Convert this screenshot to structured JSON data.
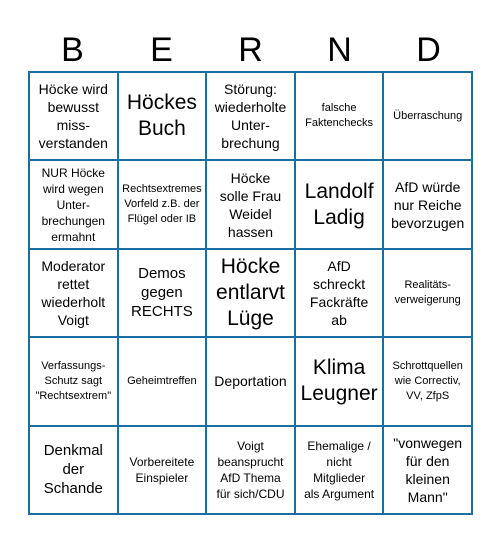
{
  "header": {
    "letters": [
      "B",
      "E",
      "R",
      "N",
      "D"
    ]
  },
  "colors": {
    "grid_border": "#1a6ea0",
    "cell_background": "#ffffff",
    "text": "#000000"
  },
  "board": {
    "rows": [
      [
        {
          "text": "Höcke wird\nbewusst\nmiss-\nverstanden",
          "size": "m"
        },
        {
          "text": "Höckes\nBuch",
          "size": "xl"
        },
        {
          "text": "Störung:\nwiederholte\nUnter-\nbrechung",
          "size": "m"
        },
        {
          "text": "falsche\nFaktenchecks",
          "size": "xs"
        },
        {
          "text": "Überraschung",
          "size": "xs"
        }
      ],
      [
        {
          "text": "NUR Höcke\nwird wegen\nUnter-\nbrechungen\nermahnt",
          "size": "s"
        },
        {
          "text": "Rechtsextremes\nVorfeld z.B. der\nFlügel oder IB",
          "size": "xs"
        },
        {
          "text": "Höcke\nsolle Frau\nWeidel\nhassen",
          "size": "m"
        },
        {
          "text": "Landolf\nLadig",
          "size": "xl"
        },
        {
          "text": "AfD würde\nnur Reiche\nbevorzugen",
          "size": "m"
        }
      ],
      [
        {
          "text": "Moderator\nrettet\nwiederholt\nVoigt",
          "size": "m"
        },
        {
          "text": "Demos\ngegen\nRECHTS",
          "size": "l"
        },
        {
          "text": "Höcke\nentlarvt\nLüge",
          "size": "xl"
        },
        {
          "text": "AfD\nschreckt\nFackräfte\nab",
          "size": "m"
        },
        {
          "text": "Realitäts-\nverweigerung",
          "size": "xs"
        }
      ],
      [
        {
          "text": "Verfassungs-\nSchutz sagt\n\"Rechtsextrem\"",
          "size": "xs"
        },
        {
          "text": "Geheimtreffen",
          "size": "xs"
        },
        {
          "text": "Deportation",
          "size": "m"
        },
        {
          "text": "Klima\nLeugner",
          "size": "xl"
        },
        {
          "text": "Schrottquellen\nwie Correctiv,\nVV, ZfpS",
          "size": "xs"
        }
      ],
      [
        {
          "text": "Denkmal\nder\nSchande",
          "size": "l"
        },
        {
          "text": "Vorbereitete\nEinspieler",
          "size": "s"
        },
        {
          "text": "Voigt\nbeansprucht\nAfD Thema\nfür sich/CDU",
          "size": "s"
        },
        {
          "text": "Ehemalige /\nnicht\nMitglieder\nals Argument",
          "size": "s"
        },
        {
          "text": "\"vonwegen\nfür den\nkleinen\nMann\"",
          "size": "m"
        }
      ]
    ]
  }
}
